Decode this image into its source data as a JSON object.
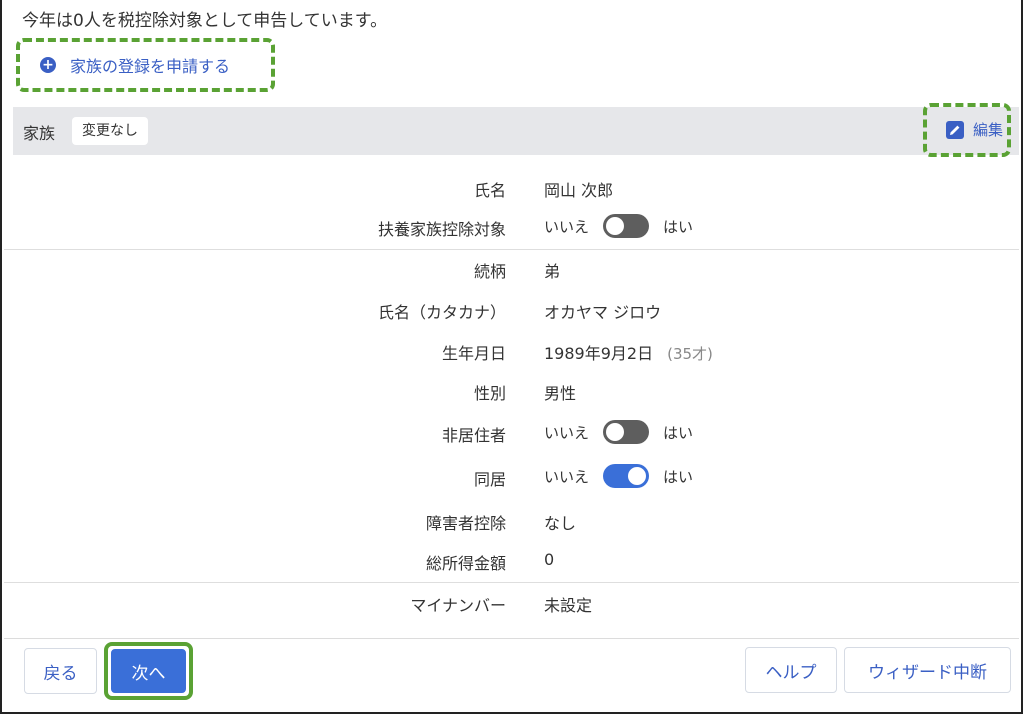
{
  "intro_text": "今年は0人を税控除対象として申告しています。",
  "apply_family_link": "家族の登録を申請する",
  "section": {
    "title": "家族",
    "badge": "変更なし",
    "edit_label": "編集"
  },
  "fields": {
    "name": {
      "label": "氏名",
      "value": "岡山 次郎"
    },
    "dependent_deduction": {
      "label": "扶養家族控除対象",
      "no": "いいえ",
      "yes": "はい",
      "on": false
    },
    "relationship": {
      "label": "続柄",
      "value": "弟"
    },
    "name_kana": {
      "label": "氏名（カタカナ）",
      "value": "オカヤマ ジロウ"
    },
    "birthdate": {
      "label": "生年月日",
      "value": "1989年9月2日",
      "age": "(35才)"
    },
    "gender": {
      "label": "性別",
      "value": "男性"
    },
    "non_resident": {
      "label": "非居住者",
      "no": "いいえ",
      "yes": "はい",
      "on": false
    },
    "cohabiting": {
      "label": "同居",
      "no": "いいえ",
      "yes": "はい",
      "on": true
    },
    "disability_deduction": {
      "label": "障害者控除",
      "value": "なし"
    },
    "total_income": {
      "label": "総所得金額",
      "value": "0"
    },
    "my_number": {
      "label": "マイナンバー",
      "value": "未設定"
    }
  },
  "footer": {
    "back": "戻る",
    "next": "次へ",
    "help": "ヘルプ",
    "abort": "ウィザード中断"
  },
  "colors": {
    "accent": "#3a6fd8",
    "link": "#3a5fc4",
    "highlight": "#5aa234"
  }
}
